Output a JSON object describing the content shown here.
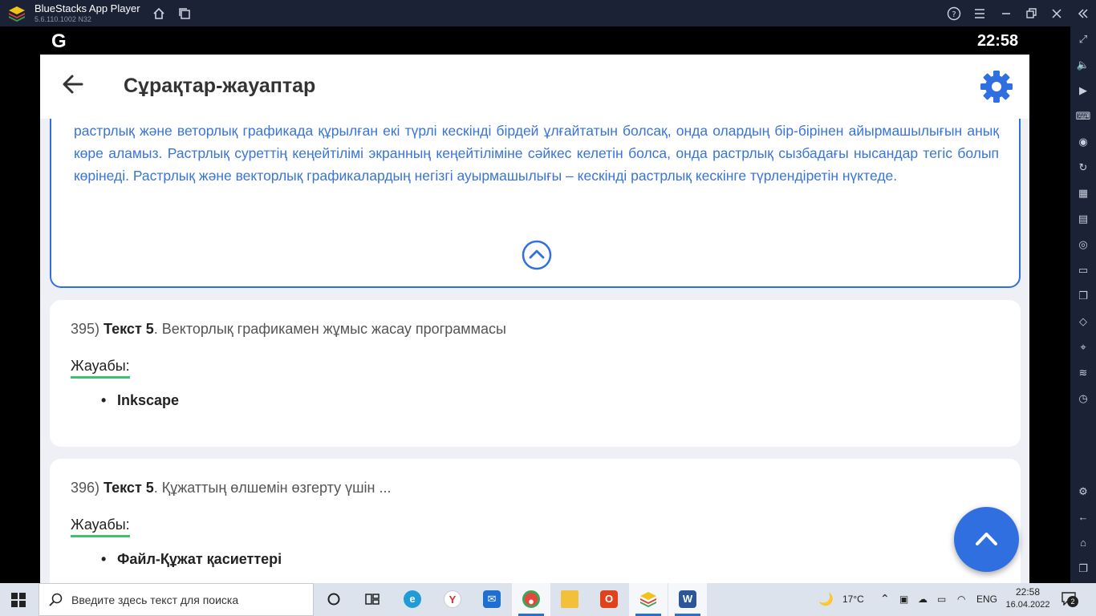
{
  "window": {
    "app_name": "BlueStacks App Player",
    "version": "5.6.110.1002 N32",
    "controls": [
      "help-icon",
      "menu-icon",
      "restore-icon",
      "close-icon",
      "collapse-sidebar-icon"
    ]
  },
  "android_status": {
    "logo": "G",
    "clock": "22:58"
  },
  "appbar": {
    "title": "Сұрақтар-жауаптар"
  },
  "expanded_answer": {
    "text": "растрлық және веторлық графикада құрылған екі түрлі кескінді бірдей ұлғайтатын болсақ, онда олардың бір-бірінен айырмашылығын анық көре аламыз. Растрлық суреттің кеңейтілімі экранның кеңейтіліміне сәйкес келетін болса, онда растрлық сызбадағы нысандар тегіс болып көрінеді. Растрлық және векторлық графикалардың негізгі ауырмашылығы – кескінді растрлық кескінге түрлендіретін нүктеде."
  },
  "questions": [
    {
      "number": "395)",
      "tag": "Текст 5",
      "text": ". Векторлық графикамен жұмыс жасау программасы",
      "answer_label": "Жауабы:",
      "answer": "Inkscape"
    },
    {
      "number": "396)",
      "tag": "Текст 5",
      "text": ". Құжаттың өлшемін өзгерту үшін ...",
      "answer_label": "Жауабы:",
      "answer": "Файл-Құжат қасиеттері"
    }
  ],
  "taskbar": {
    "search_placeholder": "Введите здесь текст для поиска",
    "weather": "17°C",
    "language": "ENG",
    "time": "22:58",
    "date": "16.04.2022",
    "notifications": "2"
  },
  "colors": {
    "accent": "#2f6fe0",
    "answer_underline": "#3ac36a",
    "expanded_text": "#3a74d8"
  }
}
